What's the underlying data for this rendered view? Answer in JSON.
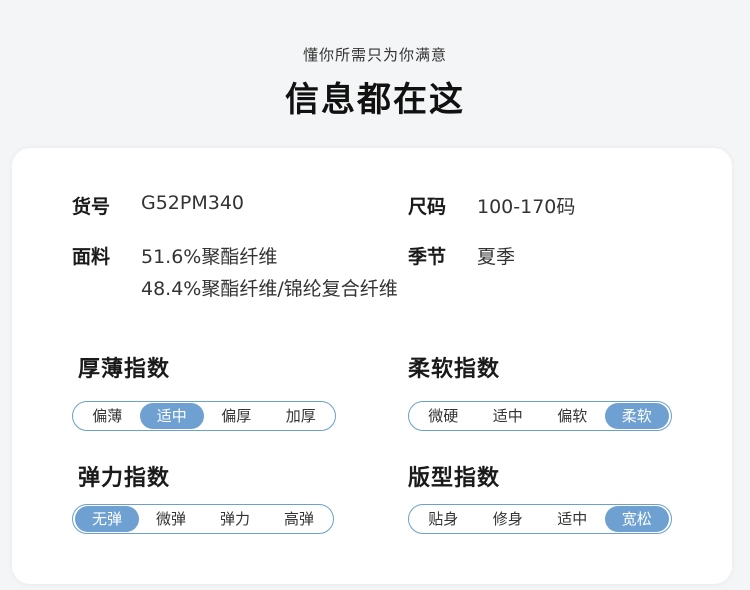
{
  "header": {
    "subtitle": "懂你所需只为你满意",
    "title": "信息都在这"
  },
  "info": {
    "item_no_label": "货号",
    "item_no_value": "G52PM340",
    "size_label": "尺码",
    "size_value": "100-170码",
    "fabric_label": "面料",
    "fabric_line1": "51.6%聚酯纤维",
    "fabric_line2": "48.4%聚酯纤维/锦纶复合纤维",
    "season_label": "季节",
    "season_value": "夏季"
  },
  "indices": {
    "thickness": {
      "title": "厚薄指数",
      "options": [
        "偏薄",
        "适中",
        "偏厚",
        "加厚"
      ],
      "selected": 1
    },
    "softness": {
      "title": "柔软指数",
      "options": [
        "微硬",
        "适中",
        "偏软",
        "柔软"
      ],
      "selected": 3
    },
    "elasticity": {
      "title": "弹力指数",
      "options": [
        "无弹",
        "微弹",
        "弹力",
        "高弹"
      ],
      "selected": 0
    },
    "fit": {
      "title": "版型指数",
      "options": [
        "贴身",
        "修身",
        "适中",
        "宽松"
      ],
      "selected": 3
    }
  },
  "colors": {
    "accent": "#6ea0d2",
    "border": "#6b9fcd"
  }
}
